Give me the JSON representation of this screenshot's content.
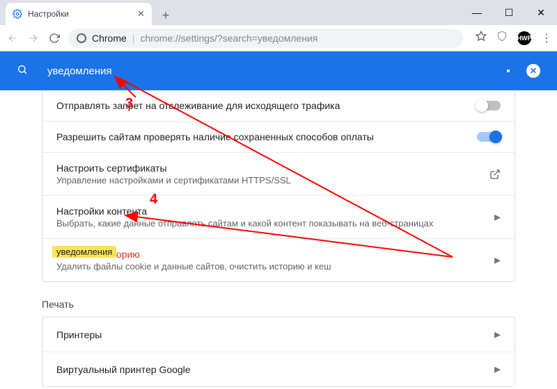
{
  "window": {
    "tab_title": "Настройки",
    "new_tab_tooltip": "+",
    "controls": {
      "min": "—",
      "max": "☐",
      "close": "✕"
    }
  },
  "toolbar": {
    "omnibox_prefix": "Chrome",
    "omnibox_rest": "chrome://settings/?search=уведомления",
    "avatar_initials": "HWP"
  },
  "search": {
    "value": "уведомления",
    "clear_label": "✕"
  },
  "rows": {
    "dnt": {
      "title": "Отправлять запрет на отслеживание для исходящего трафика",
      "enabled": false
    },
    "payments": {
      "title": "Разрешить сайтам проверять наличие сохраненных способов оплаты",
      "enabled": true
    },
    "certs": {
      "title": "Настроить сертификаты",
      "sub": "Управление настройками и сертификатами HTTPS/SSL"
    },
    "content": {
      "title": "Настройки контента",
      "sub": "Выбрать, какие данные отправлять сайтам и какой контент показывать на веб-страницах"
    },
    "clear": {
      "title": "Очистить историю",
      "sub": "Удалить файлы cookie и данные сайтов, очистить историю и кеш",
      "badge": "уведомления"
    }
  },
  "print_section": {
    "label": "Печать",
    "printers": "Принтеры",
    "cloud": "Виртуальный принтер Google"
  },
  "annotations": {
    "n3": "3",
    "n4": "4",
    "color": "#ff0000"
  }
}
